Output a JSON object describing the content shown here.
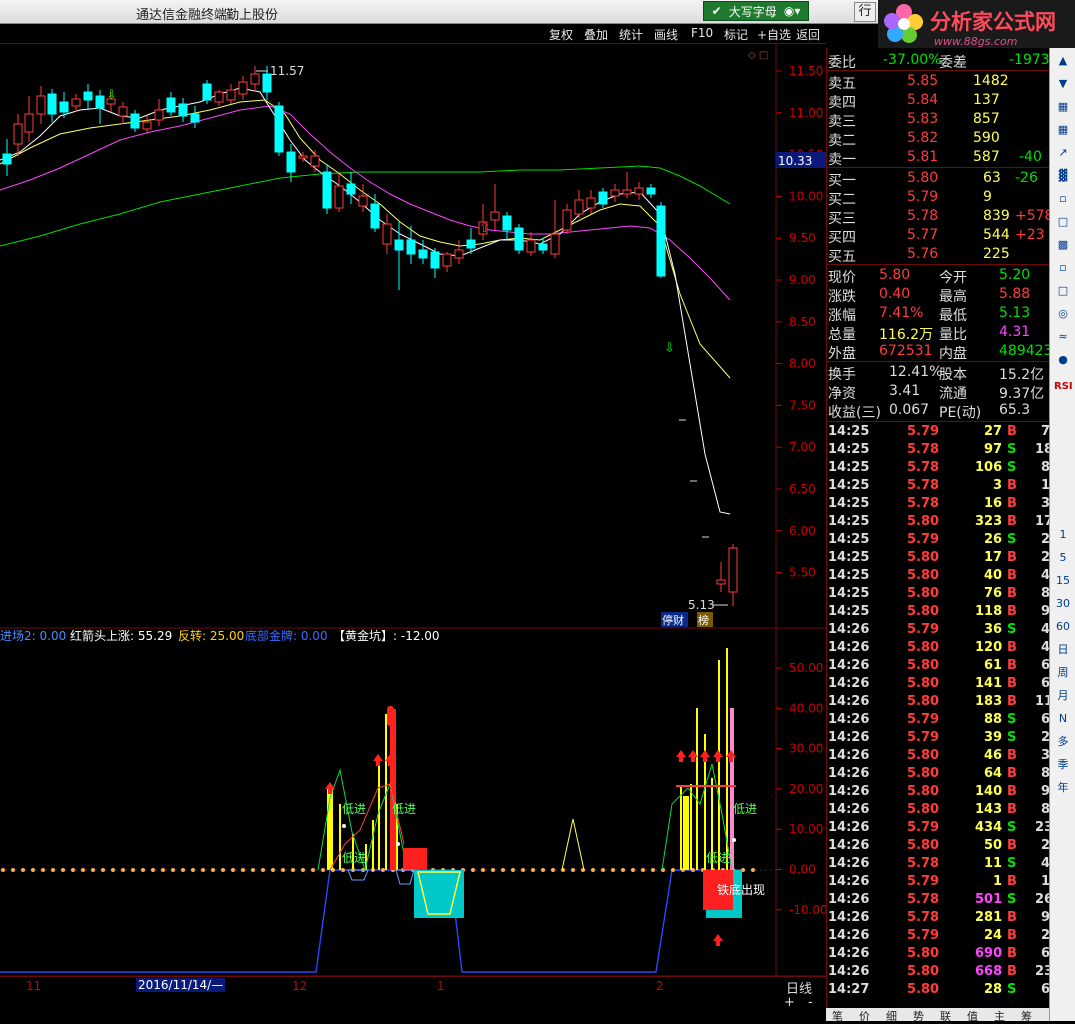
{
  "titlebar": {
    "app": "通达信金融终端",
    "stock": "勤上股份",
    "ime": "大写字母",
    "hang": "行"
  },
  "logo": {
    "title": "分析家公式网",
    "url": "www.88gs.com"
  },
  "toolbar": [
    "复权",
    "叠加",
    "统计",
    "画线",
    "F10",
    "标记",
    "+自选",
    "返回"
  ],
  "price_axis": [
    "11.50",
    "11.00",
    "10.50",
    "10.00",
    "9.50",
    "9.00",
    "8.50",
    "8.00",
    "7.50",
    "7.00",
    "6.50",
    "6.00",
    "5.50"
  ],
  "current_price_tag": "10.33",
  "high_label": "11.57",
  "low_label": "5.13",
  "badges": [
    "停财",
    "榜"
  ],
  "indicator_legend": [
    {
      "label": "进场2: 0.00",
      "color": "#4a8cff"
    },
    {
      "label": "红箭头上涨: 55.29",
      "color": "#ffffff"
    },
    {
      "label": "反转: 25.00",
      "color": "#ffd400"
    },
    {
      "label": "底部金牌: 0.00",
      "color": "#3a6cff"
    },
    {
      "label": "【黄金坑】: -12.00",
      "color": "#ffffff"
    }
  ],
  "indicator_axis": [
    "50.00",
    "40.00",
    "30.00",
    "20.00",
    "10.00",
    "0.00",
    "-10.00"
  ],
  "indicator_texts": {
    "t1": "低进",
    "t2": "低进",
    "t3": "低进",
    "t4": "低进",
    "t5": "低进",
    "t6": "铁底出现"
  },
  "date_axis": {
    "d1": "11",
    "d2": "2016/11/14/—",
    "d3": "12",
    "d4": "1",
    "d5": "2"
  },
  "bottom": {
    "period": "日线",
    "plus": "+",
    "minus": "-"
  },
  "quote": {
    "weibi": {
      "label": "委比",
      "value": "-37.00%",
      "label2": "委差",
      "value2": "-1973"
    },
    "asks": [
      {
        "label": "卖五",
        "price": "5.85",
        "vol": "1482",
        "chg": ""
      },
      {
        "label": "卖四",
        "price": "5.84",
        "vol": "137",
        "chg": ""
      },
      {
        "label": "卖三",
        "price": "5.83",
        "vol": "857",
        "chg": ""
      },
      {
        "label": "卖二",
        "price": "5.82",
        "vol": "590",
        "chg": ""
      },
      {
        "label": "卖一",
        "price": "5.81",
        "vol": "587",
        "chg": "-40"
      }
    ],
    "bids": [
      {
        "label": "买一",
        "price": "5.80",
        "vol": "63",
        "chg": "-26"
      },
      {
        "label": "买二",
        "price": "5.79",
        "vol": "9",
        "chg": ""
      },
      {
        "label": "买三",
        "price": "5.78",
        "vol": "839",
        "chg": "+578"
      },
      {
        "label": "买四",
        "price": "5.77",
        "vol": "544",
        "chg": "+23"
      },
      {
        "label": "买五",
        "price": "5.76",
        "vol": "225",
        "chg": ""
      }
    ],
    "stats": [
      {
        "l1": "现价",
        "v1": "5.80",
        "c1": "#ff3b3b",
        "l2": "今开",
        "v2": "5.20",
        "c2": "#00e000"
      },
      {
        "l1": "涨跌",
        "v1": "0.40",
        "c1": "#ff3b3b",
        "l2": "最高",
        "v2": "5.88",
        "c2": "#ff3b3b"
      },
      {
        "l1": "涨幅",
        "v1": "7.41%",
        "c1": "#ff3b3b",
        "l2": "最低",
        "v2": "5.13",
        "c2": "#00e000"
      },
      {
        "l1": "总量",
        "v1": "116.2万",
        "c1": "#ffff55",
        "l2": "量比",
        "v2": "4.31",
        "c2": "#ff44ff"
      },
      {
        "l1": "外盘",
        "v1": "672531",
        "c1": "#ff3b3b",
        "l2": "内盘",
        "v2": "489423",
        "c2": "#00e000"
      }
    ],
    "stats2": [
      {
        "l1": "换手",
        "v1": "12.41%",
        "l2": "股本",
        "v2": "15.2亿"
      },
      {
        "l1": "净资",
        "v1": "3.41",
        "l2": "流通",
        "v2": "9.37亿"
      },
      {
        "l1": "收益(三)",
        "v1": "0.067",
        "l2": "PE(动)",
        "v2": "65.3"
      }
    ],
    "ticks": [
      [
        "14:25",
        "5.79",
        "27",
        "B",
        "7"
      ],
      [
        "14:25",
        "5.78",
        "97",
        "S",
        "18"
      ],
      [
        "14:25",
        "5.78",
        "106",
        "S",
        "8"
      ],
      [
        "14:25",
        "5.78",
        "3",
        "B",
        "1"
      ],
      [
        "14:25",
        "5.78",
        "16",
        "B",
        "3"
      ],
      [
        "14:25",
        "5.80",
        "323",
        "B",
        "17"
      ],
      [
        "14:25",
        "5.79",
        "26",
        "S",
        "2"
      ],
      [
        "14:25",
        "5.80",
        "17",
        "B",
        "2"
      ],
      [
        "14:25",
        "5.80",
        "40",
        "B",
        "4"
      ],
      [
        "14:25",
        "5.80",
        "76",
        "B",
        "8"
      ],
      [
        "14:25",
        "5.80",
        "118",
        "B",
        "9"
      ],
      [
        "14:26",
        "5.79",
        "36",
        "S",
        "4"
      ],
      [
        "14:26",
        "5.80",
        "120",
        "B",
        "4"
      ],
      [
        "14:26",
        "5.80",
        "61",
        "B",
        "6"
      ],
      [
        "14:26",
        "5.80",
        "141",
        "B",
        "6"
      ],
      [
        "14:26",
        "5.80",
        "183",
        "B",
        "11"
      ],
      [
        "14:26",
        "5.79",
        "88",
        "S",
        "6"
      ],
      [
        "14:26",
        "5.79",
        "39",
        "S",
        "2"
      ],
      [
        "14:26",
        "5.80",
        "46",
        "B",
        "3"
      ],
      [
        "14:26",
        "5.80",
        "64",
        "B",
        "8"
      ],
      [
        "14:26",
        "5.80",
        "140",
        "B",
        "9"
      ],
      [
        "14:26",
        "5.80",
        "143",
        "B",
        "8"
      ],
      [
        "14:26",
        "5.79",
        "434",
        "S",
        "23"
      ],
      [
        "14:26",
        "5.80",
        "50",
        "B",
        "2"
      ],
      [
        "14:26",
        "5.78",
        "11",
        "S",
        "4"
      ],
      [
        "14:26",
        "5.79",
        "1",
        "B",
        "1"
      ],
      [
        "14:26",
        "5.78",
        "501",
        "S",
        "26"
      ],
      [
        "14:26",
        "5.78",
        "281",
        "B",
        "9"
      ],
      [
        "14:26",
        "5.79",
        "24",
        "B",
        "2"
      ],
      [
        "14:26",
        "5.80",
        "690",
        "B",
        "6"
      ],
      [
        "14:26",
        "5.80",
        "668",
        "B",
        "23"
      ],
      [
        "14:27",
        "5.80",
        "28",
        "S",
        "6"
      ]
    ],
    "tabs": [
      "笔",
      "价",
      "细",
      "势",
      "联",
      "值",
      "主",
      "筹"
    ]
  },
  "right_toolbar": [
    "1",
    "5",
    "15",
    "30",
    "60",
    "日",
    "周",
    "月",
    "N",
    "多",
    "季",
    "年",
    "RSI"
  ],
  "colors": {
    "up": "#ff3b3b",
    "down": "#00ffff",
    "ma5": "#ffffff",
    "ma10": "#ffff66",
    "ma20": "#ff44ff",
    "ma60": "#00dd00",
    "frame": "#6d0b0b"
  }
}
